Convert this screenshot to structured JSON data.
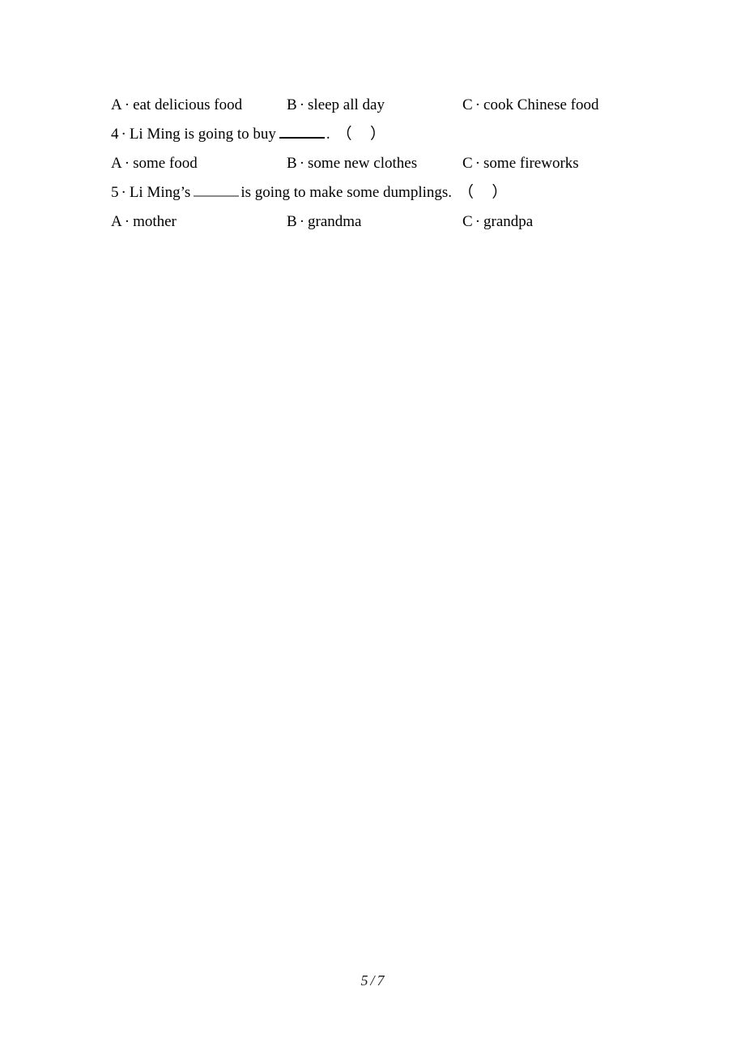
{
  "document": {
    "page_label": "5 / 7",
    "page_current": "5",
    "page_separator": "/",
    "page_total": "7"
  },
  "content": {
    "separator": "·",
    "paren_open": "（",
    "paren_close": "）",
    "period": ".",
    "blocks": [
      {
        "kind": "options",
        "name": "options-row-3",
        "items": [
          {
            "letter": "A",
            "text": "eat delicious food"
          },
          {
            "letter": "B",
            "text": "sleep all day"
          },
          {
            "letter": "C",
            "text": "cook Chinese food"
          }
        ]
      },
      {
        "kind": "stem",
        "name": "question-4",
        "number": "4",
        "text_before": "Li Ming is going to buy",
        "blank": true,
        "blank_style": "dark",
        "text_after": ".",
        "has_answer_paren": true
      },
      {
        "kind": "options",
        "name": "options-row-4",
        "items": [
          {
            "letter": "A",
            "text": "some food"
          },
          {
            "letter": "B",
            "text": "some new clothes"
          },
          {
            "letter": "C",
            "text": "some fireworks"
          }
        ]
      },
      {
        "kind": "stem",
        "name": "question-5",
        "number": "5",
        "text_before": "Li Ming’s",
        "blank": true,
        "blank_style": "light",
        "text_after": "is going to make some dumplings.",
        "has_answer_paren": true
      },
      {
        "kind": "options",
        "name": "options-row-5",
        "items": [
          {
            "letter": "A",
            "text": "mother"
          },
          {
            "letter": "B",
            "text": "grandma"
          },
          {
            "letter": "C",
            "text": "grandpa"
          }
        ]
      }
    ]
  }
}
